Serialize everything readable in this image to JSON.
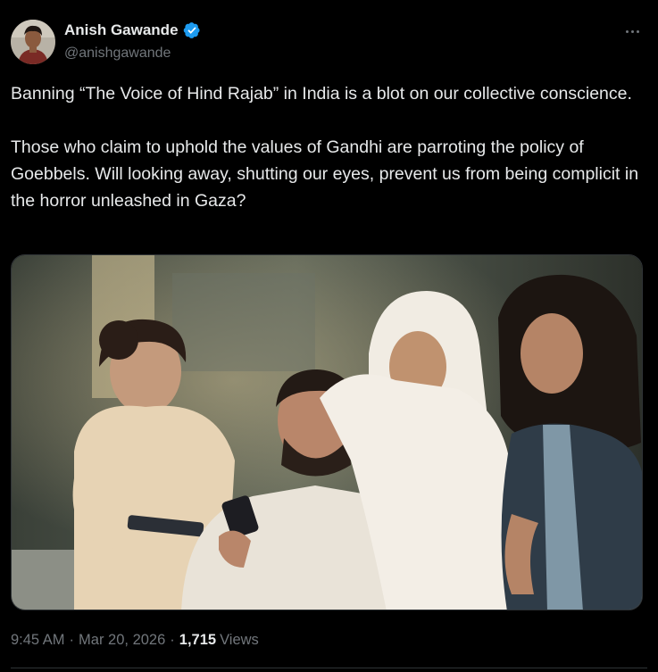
{
  "author": {
    "display_name": "Anish Gawande",
    "handle": "@anishgawande",
    "verified": true
  },
  "icons": {
    "verified": "verified-badge-icon",
    "more": "more-options-icon"
  },
  "colors": {
    "background": "#000000",
    "primary_text": "#e7e9ea",
    "secondary_text": "#71767b",
    "verified_blue": "#1d9bf0",
    "divider": "#2f3336"
  },
  "tweet": {
    "paragraph_1": "Banning “The Voice of Hind Rajab” in India is a blot on our collective conscience.",
    "paragraph_2": "Those who claim to uphold the values of Gandhi are parroting the policy of Goebbels. Will looking away, shutting our eyes, prevent us from being complicit in the horror unleashed in Gaza?"
  },
  "meta": {
    "time": "9:45 AM",
    "separator": "·",
    "date": "Mar 20, 2026",
    "views_count": "1,715",
    "views_label": "Views"
  }
}
